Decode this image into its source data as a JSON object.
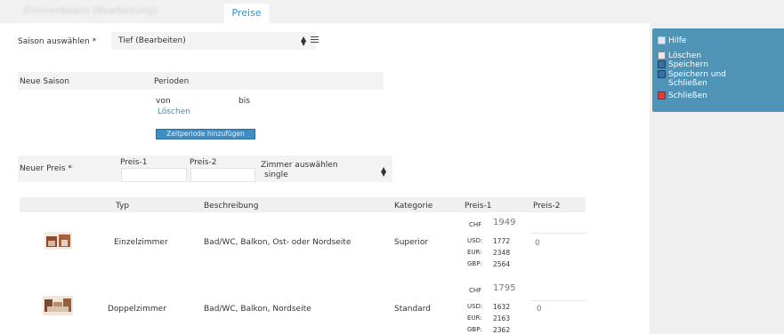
{
  "tabs": {
    "blurred_label": "Zimmerdetails (Bearbeitung)",
    "active_label": "Preise"
  },
  "sidebar": {
    "help": "Hilfe",
    "delete": "Löschen",
    "save": "Speichern",
    "save_close": "Speichern und Schließen",
    "close": "Schließen"
  },
  "form": {
    "season_label": "Saison auswählen *",
    "season_value": "Tief (Bearbeiten)",
    "new_season_label": "Neue Saison",
    "periods_label": "Perioden",
    "from_label": "von",
    "to_label": "bis",
    "delete_link": "Löschen",
    "add_period_button": "Zeitperiode hinzufügen",
    "new_price_label": "Neuer Preis *",
    "price1_label": "Preis-1",
    "price2_label": "Preis-2",
    "room_select_label": "Zimmer auswählen",
    "room_select_value": "single"
  },
  "table": {
    "headers": [
      "Typ",
      "Beschreibung",
      "Kategorie",
      "Preis-1",
      "Preis-2"
    ],
    "rows": [
      {
        "type": "Einzelzimmer",
        "description": "Bad/WC, Balkon, Ost- oder Nordseite",
        "category": "Superior",
        "chf_label": "CHF",
        "chf_value": "1949",
        "usd_label": "USD:",
        "usd_value": "1772",
        "eur_label": "EUR:",
        "eur_value": "2348",
        "gbp_label": "GBP:",
        "gbp_value": "2564",
        "price2": "0"
      },
      {
        "type": "Doppelzimmer",
        "description": "Bad/WC, Balkon, Nordseite",
        "category": "Standard",
        "chf_label": "CHF",
        "chf_value": "1795",
        "usd_label": "USD:",
        "usd_value": "1632",
        "eur_label": "EUR:",
        "eur_value": "2163",
        "gbp_label": "GBP:",
        "gbp_value": "2362",
        "price2": "0"
      }
    ]
  },
  "colors": {
    "accent": "#3a8fc0",
    "sidebar_bg": "#4f94b6",
    "button_bg": "#3d8ec4"
  }
}
